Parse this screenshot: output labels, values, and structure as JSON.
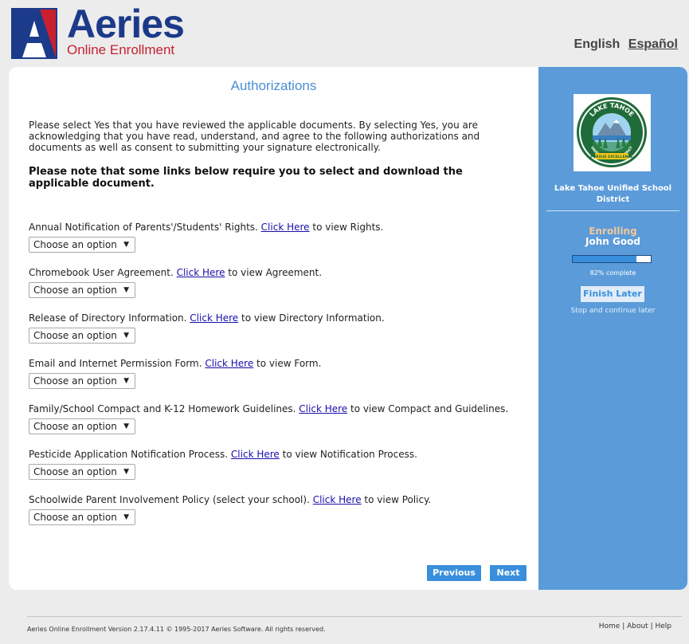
{
  "header": {
    "brand_name": "Aeries",
    "brand_sub": "Online Enrollment",
    "lang_english": "English",
    "lang_spanish": "Español"
  },
  "main": {
    "title": "Authorizations",
    "intro": "Please select Yes that you have reviewed the applicable documents. By selecting Yes, you are acknowledging that you have read, understand, and agree to the following authorizations and documents as well as consent to submitting your signature electronically.",
    "note": "Please note that some links below require you to select and download the applicable document.",
    "select_placeholder": "Choose an option",
    "items": [
      {
        "prefix": "Annual Notification of Parents'/Students' Rights. ",
        "link": "Click Here",
        "suffix": " to view Rights.",
        "value": "Choose an option"
      },
      {
        "prefix": "Chromebook User Agreement. ",
        "link": "Click Here",
        "suffix": " to view Agreement.",
        "value": "Choose an option"
      },
      {
        "prefix": "Release of Directory Information. ",
        "link": "Click Here",
        "suffix": " to view Directory Information.",
        "value": "Choose an option"
      },
      {
        "prefix": "Email and Internet Permission Form. ",
        "link": "Click Here",
        "suffix": " to view Form.",
        "value": "Choose an option"
      },
      {
        "prefix": "Family/School Compact and K-12 Homework Guidelines. ",
        "link": "Click Here",
        "suffix": " to view Compact and Guidelines.",
        "value": "Choose an option"
      },
      {
        "prefix": "Pesticide Application Notification Process. ",
        "link": "Click Here",
        "suffix": " to view Notification Process.",
        "value": "Choose an option"
      },
      {
        "prefix": "Schoolwide Parent Involvement Policy (select your school). ",
        "link": "Click Here",
        "suffix": " to view Policy.",
        "value": "Choose an option"
      }
    ],
    "prev_label": "Previous",
    "next_label": "Next"
  },
  "sidebar": {
    "seal_text_top": "LAKE TAHOE",
    "seal_text_side": "UNIFIED SCHOOL DISTRICT",
    "seal_motto": "PURSUE EXCELLENCE",
    "district_name": "Lake Tahoe Unified School District",
    "enrolling_label": "Enrolling",
    "student_name": "John Good",
    "progress_fraction": 0.82,
    "progress_text": "82% complete",
    "finish_later_label": "Finish Later",
    "stop_text": "Stop and continue later"
  },
  "footer": {
    "version_text": "Aeries Online Enrollment Version 2.17.4.11 © 1995-2017 Aeries Software. All rights reserved.",
    "home": "Home",
    "about": "About",
    "help": "Help",
    "sep": " | "
  },
  "colors": {
    "brand_blue": "#1c3a8a",
    "brand_red": "#c8202f",
    "accent_blue": "#3a8fdc",
    "sidebar_blue": "#5b9bd9",
    "enrolling_orange": "#f5c79a"
  }
}
